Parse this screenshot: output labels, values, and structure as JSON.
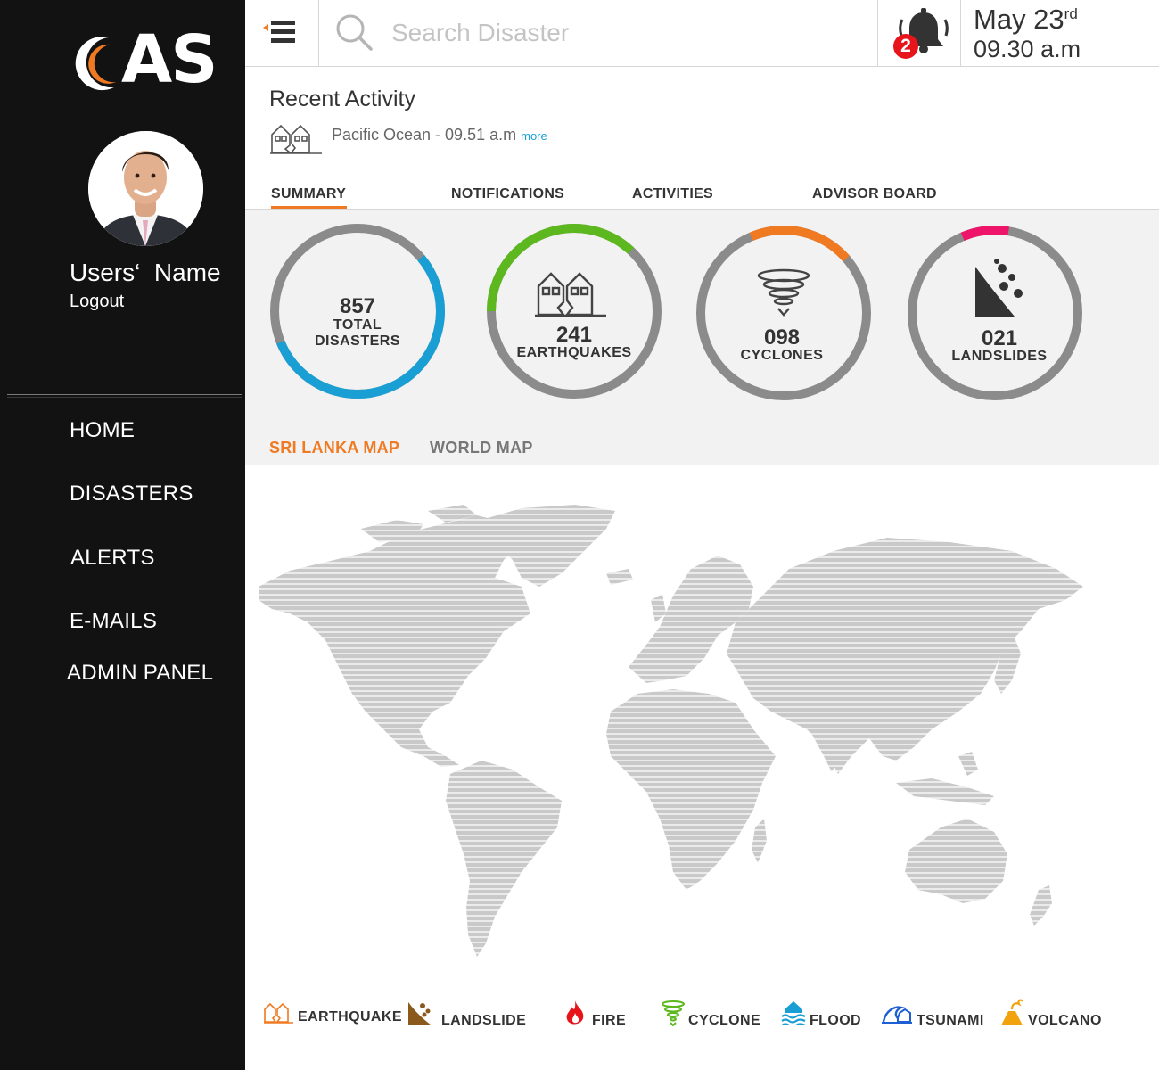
{
  "app": {
    "logo_text": "AS"
  },
  "user": {
    "name": "Users‘  Name",
    "logout_label": "Logout"
  },
  "nav": [
    {
      "label": "HOME"
    },
    {
      "label": "DISASTERS"
    },
    {
      "label": "ALERTS"
    },
    {
      "label": "E-MAILS"
    },
    {
      "label": "ADMIN PANEL"
    }
  ],
  "search": {
    "placeholder": "Search Disaster"
  },
  "notifications": {
    "count": "2"
  },
  "datetime": {
    "date_main": "May 23",
    "date_suffix": "rd",
    "time": "09.30 a.m"
  },
  "recent_activity": {
    "title": "Recent Activity",
    "text": "Pacific Ocean - 09.51 a.m",
    "more_label": "more"
  },
  "tabs": [
    {
      "label": "SUMMARY",
      "active": true
    },
    {
      "label": "NOTIFICATIONS"
    },
    {
      "label": "ACTIVITIES"
    },
    {
      "label": "ADVISOR BOARD"
    }
  ],
  "stats": [
    {
      "value": "857",
      "label_1": "TOTAL",
      "label_2": "DISASTERS",
      "fraction": 0.55,
      "start_angle": -40,
      "color": "#1a9fd4"
    },
    {
      "value": "241",
      "label_1": "EARTHQUAKES",
      "fraction": 0.37,
      "start_angle": 180,
      "color": "#5cb81e"
    },
    {
      "value": "098",
      "label_1": "CYCLONES",
      "fraction": 0.2,
      "start_angle": 247,
      "color": "#f07a22"
    },
    {
      "value": "021",
      "label_1": "LANDSLIDES",
      "fraction": 0.09,
      "start_angle": 247,
      "color": "#ee1469"
    }
  ],
  "map_tabs": [
    {
      "label": "SRI LANKA MAP",
      "active": true,
      "color": "#f07a22"
    },
    {
      "label": "WORLD MAP",
      "active": false,
      "color": "#777777"
    }
  ],
  "legend": [
    {
      "label": "EARTHQUAKE",
      "icon": "earthquake-icon",
      "color": "#f07a22"
    },
    {
      "label": "LANDSLIDE",
      "icon": "landslide-icon",
      "color": "#8a5a1c"
    },
    {
      "label": "FIRE",
      "icon": "fire-icon",
      "color": "#e8141c"
    },
    {
      "label": "CYCLONE",
      "icon": "cyclone-icon",
      "color": "#5cb81e"
    },
    {
      "label": "FLOOD",
      "icon": "flood-icon",
      "color": "#1a9fd4"
    },
    {
      "label": "TSUNAMI",
      "icon": "tsunami-icon",
      "color": "#1f5fd4"
    },
    {
      "label": "VOLCANO",
      "icon": "volcano-icon",
      "color": "#f2a20c"
    }
  ]
}
